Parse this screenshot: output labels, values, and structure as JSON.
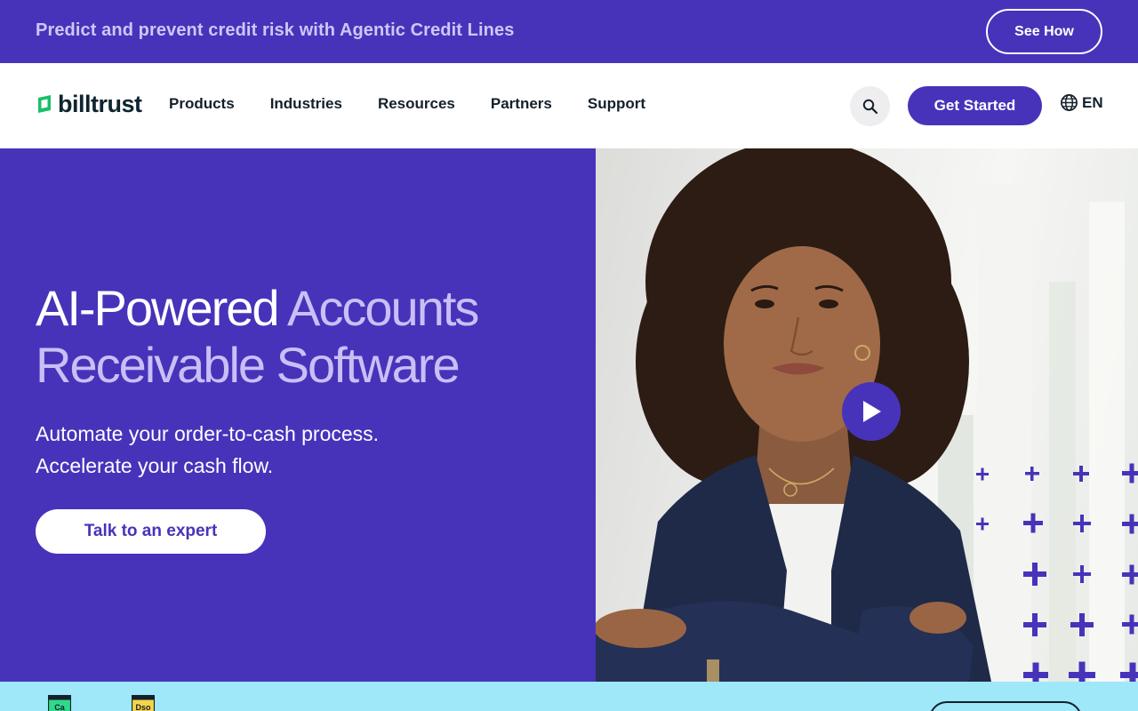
{
  "announcement": {
    "text": "Predict and prevent credit risk with Agentic Credit Lines",
    "button_label": "See How"
  },
  "header": {
    "logo_text": "billtrust",
    "nav": [
      "Products",
      "Industries",
      "Resources",
      "Partners",
      "Support"
    ],
    "search_icon": "search-icon",
    "cta_label": "Get Started",
    "language": "EN",
    "language_icon": "globe-icon"
  },
  "hero": {
    "title_strong": "AI-Powered",
    "title_rest": "Accounts Receivable Software",
    "subtitle_line1": "Automate your order-to-cash process.",
    "subtitle_line2": "Accelerate your cash flow.",
    "cta_label": "Talk to an expert",
    "play_icon": "play-icon"
  },
  "badges": {
    "badge1_text": "Ca",
    "badge2_text": "Dso"
  },
  "colors": {
    "brand_purple": "#4733BA",
    "light_purple": "#C9BFF6",
    "strip_cyan": "#9EE8FA",
    "logo_green": "#1BBF6A"
  }
}
